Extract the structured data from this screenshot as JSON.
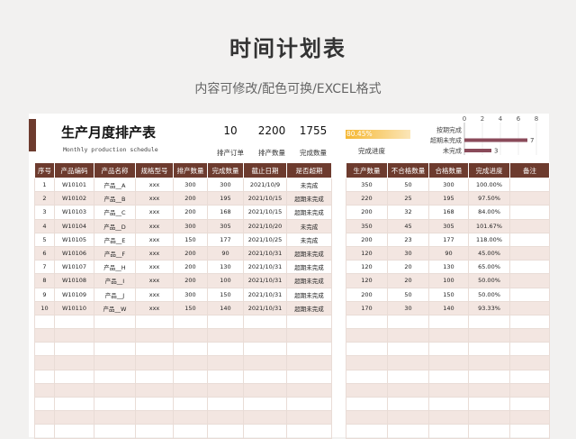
{
  "header": {
    "title": "时间计划表",
    "subtitle": "内容可修改/配色可换/EXCEL格式"
  },
  "sheet": {
    "title": "生产月度排产表",
    "subtitle": "Monthly production schedule",
    "kpis": [
      {
        "value": "10",
        "label": "排产订单"
      },
      {
        "value": "2200",
        "label": "排产数量"
      },
      {
        "value": "1755",
        "label": "完成数量"
      }
    ],
    "progress": {
      "value_text": "80.45%",
      "fraction": 0.8045,
      "label": "完成进度"
    }
  },
  "chart_data": {
    "type": "bar",
    "orientation": "horizontal",
    "categories": [
      "按期完成",
      "超期未完成",
      "未完成"
    ],
    "values": [
      0,
      7,
      3
    ],
    "xlim": [
      0,
      8
    ],
    "xticks": [
      "0",
      "2",
      "4",
      "6",
      "8"
    ],
    "data_labels": [
      "",
      "7",
      "3"
    ],
    "bar_color": "#8a4a5a"
  },
  "left_table": {
    "headers": [
      "序号",
      "产品编码",
      "产品名称",
      "规格型号",
      "排产数量",
      "完成数量",
      "截止日期",
      "是否超期"
    ],
    "rows": [
      [
        "1",
        "W10101",
        "产品__A",
        "xxx",
        "300",
        "300",
        "2021/10/9",
        "未完成"
      ],
      [
        "2",
        "W10102",
        "产品__B",
        "xxx",
        "200",
        "195",
        "2021/10/15",
        "超期未完成"
      ],
      [
        "3",
        "W10103",
        "产品__C",
        "xxx",
        "200",
        "168",
        "2021/10/15",
        "超期未完成"
      ],
      [
        "4",
        "W10104",
        "产品__D",
        "xxx",
        "300",
        "305",
        "2021/10/20",
        "未完成"
      ],
      [
        "5",
        "W10105",
        "产品__E",
        "xxx",
        "150",
        "177",
        "2021/10/25",
        "未完成"
      ],
      [
        "6",
        "W10106",
        "产品__F",
        "xxx",
        "200",
        "90",
        "2021/10/31",
        "超期未完成"
      ],
      [
        "7",
        "W10107",
        "产品__H",
        "xxx",
        "200",
        "130",
        "2021/10/31",
        "超期未完成"
      ],
      [
        "8",
        "W10108",
        "产品__I",
        "xxx",
        "200",
        "100",
        "2021/10/31",
        "超期未完成"
      ],
      [
        "9",
        "W10109",
        "产品__J",
        "xxx",
        "300",
        "150",
        "2021/10/31",
        "超期未完成"
      ],
      [
        "10",
        "W10110",
        "产品__W",
        "xxx",
        "150",
        "140",
        "2021/10/31",
        "超期未完成"
      ]
    ],
    "empty_rows": 9
  },
  "right_table": {
    "headers": [
      "生产数量",
      "不合格数量",
      "合格数量",
      "完成进度",
      "备注"
    ],
    "rows": [
      [
        "350",
        "50",
        "300",
        "100.00%",
        ""
      ],
      [
        "220",
        "25",
        "195",
        "97.50%",
        ""
      ],
      [
        "200",
        "32",
        "168",
        "84.00%",
        ""
      ],
      [
        "350",
        "45",
        "305",
        "101.67%",
        ""
      ],
      [
        "200",
        "23",
        "177",
        "118.00%",
        ""
      ],
      [
        "120",
        "30",
        "90",
        "45.00%",
        ""
      ],
      [
        "120",
        "20",
        "130",
        "65.00%",
        ""
      ],
      [
        "120",
        "20",
        "100",
        "50.00%",
        ""
      ],
      [
        "200",
        "50",
        "150",
        "50.00%",
        ""
      ],
      [
        "170",
        "30",
        "140",
        "93.33%",
        ""
      ]
    ],
    "empty_rows": 9
  }
}
